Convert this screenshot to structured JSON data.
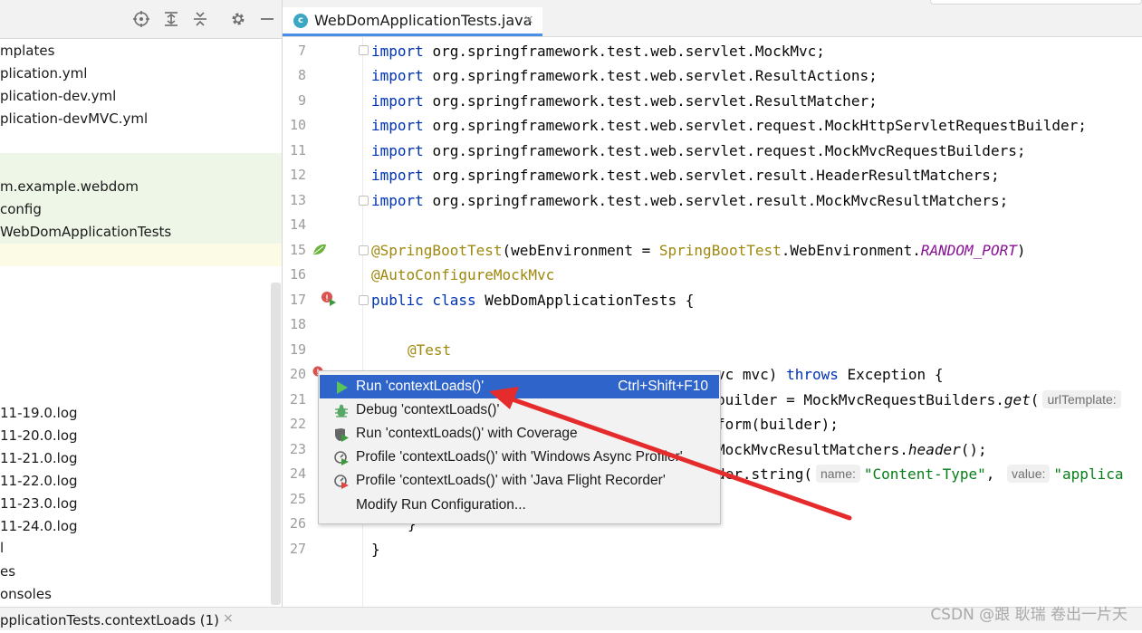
{
  "project_tree": {
    "items": [
      "mplates",
      "plication.yml",
      "plication-dev.yml",
      "plication-devMVC.yml",
      "m.example.webdom",
      "config",
      "WebDomApplicationTests",
      "11-19.0.log",
      "11-20.0.log",
      "11-21.0.log",
      "11-22.0.log",
      "11-23.0.log",
      "11-24.0.log",
      "l",
      "es",
      "onsoles"
    ]
  },
  "toolbar": {
    "icons": [
      "crosshair-icon",
      "expand-all-icon",
      "collapse-all-icon",
      "gear-icon",
      "minimize-icon"
    ]
  },
  "editor": {
    "tab_label": "WebDomApplicationTests.java",
    "tab_close": "×",
    "line_numbers": [
      "7",
      "8",
      "9",
      "10",
      "11",
      "12",
      "13",
      "14",
      "15",
      "16",
      "17",
      "18",
      "19",
      "20",
      "21",
      "22",
      "23",
      "24",
      "25",
      "26",
      "27"
    ],
    "imports": [
      "org.springframework.test.web.servlet.MockMvc;",
      "org.springframework.test.web.servlet.ResultActions;",
      "org.springframework.test.web.servlet.ResultMatcher;",
      "org.springframework.test.web.servlet.request.MockHttpServletRequestBuilder;",
      "org.springframework.test.web.servlet.request.MockMvcRequestBuilders;",
      "org.springframework.test.web.servlet.result.HeaderResultMatchers;",
      "org.springframework.test.web.servlet.result.MockMvcResultMatchers;"
    ],
    "kw_import": "import",
    "line15": {
      "ann": "@SpringBootTest",
      "p1": "(webEnvironment = ",
      "cls": "SpringBootTest",
      "p2": ".WebEnvironment.",
      "const": "RANDOM_PORT",
      "p3": ")"
    },
    "line16": "@AutoConfigureMockMvc",
    "line17": {
      "kw": "public class",
      "rest": " WebDomApplicationTests {"
    },
    "line19": "@Test",
    "line20": {
      "pre": "vc mvc) ",
      "kw": "throws",
      "rest": " Exception {"
    },
    "line21": {
      "pre": "builder = MockMvcRequestBuilders.",
      "method": "get",
      "paren": "(",
      "hint": "urlTemplate:"
    },
    "line22": "form(builder);",
    "line23": {
      "pre": "MockMvcResultMatchers.",
      "method": "header",
      "rest": "();"
    },
    "line24": {
      "pre": "der.string(",
      "hint1": "name:",
      "str1": "\"Content-Type\"",
      "comma": ",",
      "hint2": "value:",
      "str2": "\"applica"
    },
    "line26": "}",
    "line27": "}"
  },
  "context_menu": {
    "items": [
      {
        "label": "Run 'contextLoads()'",
        "shortcut": "Ctrl+Shift+F10",
        "icon": "run-icon",
        "selected": true
      },
      {
        "label": "Debug 'contextLoads()'",
        "shortcut": "",
        "icon": "debug-icon",
        "selected": false
      },
      {
        "label": "Run 'contextLoads()' with Coverage",
        "shortcut": "",
        "icon": "coverage-icon",
        "selected": false
      },
      {
        "label": "Profile 'contextLoads()' with 'Windows Async Profiler'",
        "shortcut": "",
        "icon": "profiler-icon",
        "selected": false
      },
      {
        "label": "Profile 'contextLoads()' with 'Java Flight Recorder'",
        "shortcut": "",
        "icon": "flight-recorder-icon",
        "selected": false
      },
      {
        "label": "Modify Run Configuration...",
        "shortcut": "",
        "icon": "",
        "selected": false
      }
    ]
  },
  "bottom": {
    "tab_label": "pplicationTests.contextLoads (1)",
    "tab_close": "×",
    "watermark": "CSDN @跟 耿瑞 卷出一片天"
  },
  "colors": {
    "accent": "#2f65ca",
    "keyword": "#0033b3",
    "annotation": "#9e880d",
    "string": "#067d17",
    "arrow": "#e52b2b"
  }
}
